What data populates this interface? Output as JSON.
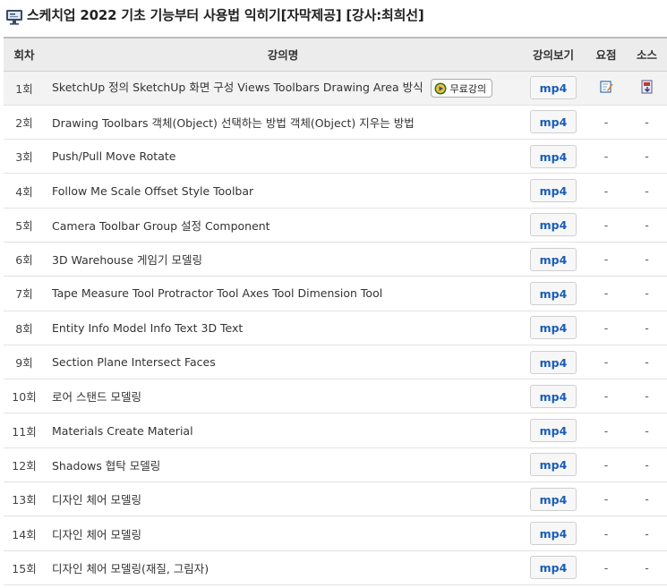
{
  "page": {
    "title": "스케치업 2022 기초 기능부터 사용법 익히기[자막제공] [강사:최희선]",
    "title_icon": "monitor-lecture-icon"
  },
  "table": {
    "headers": {
      "no": "회차",
      "name": "강의명",
      "video": "강의보기",
      "summary": "요점",
      "source": "소스"
    },
    "rows": [
      {
        "no": "1회",
        "name": "SketchUp 정의 SketchUp 화면 구성 Views Toolbars Drawing Area 방식",
        "badge": "무료강의",
        "video": "mp4",
        "summary": "note-edit-icon",
        "source": "download-file-icon"
      },
      {
        "no": "2회",
        "name": "Drawing Toolbars 객체(Object) 선택하는 방법 객체(Object) 지우는 방법",
        "video": "mp4",
        "summary": "-",
        "source": "-"
      },
      {
        "no": "3회",
        "name": "Push/Pull Move Rotate",
        "video": "mp4",
        "summary": "-",
        "source": "-"
      },
      {
        "no": "4회",
        "name": "Follow Me Scale Offset Style Toolbar",
        "video": "mp4",
        "summary": "-",
        "source": "-"
      },
      {
        "no": "5회",
        "name": "Camera Toolbar Group 설정 Component",
        "video": "mp4",
        "summary": "-",
        "source": "-"
      },
      {
        "no": "6회",
        "name": "3D Warehouse 게임기 모델링",
        "video": "mp4",
        "summary": "-",
        "source": "-"
      },
      {
        "no": "7회",
        "name": "Tape Measure Tool Protractor Tool Axes Tool Dimension Tool",
        "video": "mp4",
        "summary": "-",
        "source": "-"
      },
      {
        "no": "8회",
        "name": "Entity Info Model Info Text 3D Text",
        "video": "mp4",
        "summary": "-",
        "source": "-"
      },
      {
        "no": "9회",
        "name": "Section Plane Intersect Faces",
        "video": "mp4",
        "summary": "-",
        "source": "-"
      },
      {
        "no": "10회",
        "name": "로어 스탠드 모델링",
        "video": "mp4",
        "summary": "-",
        "source": "-"
      },
      {
        "no": "11회",
        "name": "Materials Create Material",
        "video": "mp4",
        "summary": "-",
        "source": "-"
      },
      {
        "no": "12회",
        "name": "Shadows 협탁 모델링",
        "video": "mp4",
        "summary": "-",
        "source": "-"
      },
      {
        "no": "13회",
        "name": "디자인 체어 모델링",
        "video": "mp4",
        "summary": "-",
        "source": "-"
      },
      {
        "no": "14회",
        "name": "디자인 체어 모델링",
        "video": "mp4",
        "summary": "-",
        "source": "-"
      },
      {
        "no": "15회",
        "name": "디자인 체어 모델링(재질, 그림자)",
        "video": "mp4",
        "summary": "-",
        "source": "-"
      }
    ]
  },
  "colors": {
    "header_bg": "#ececec",
    "mp4_text": "#1a5db8",
    "first_row_bg": "#f3f3f3"
  }
}
